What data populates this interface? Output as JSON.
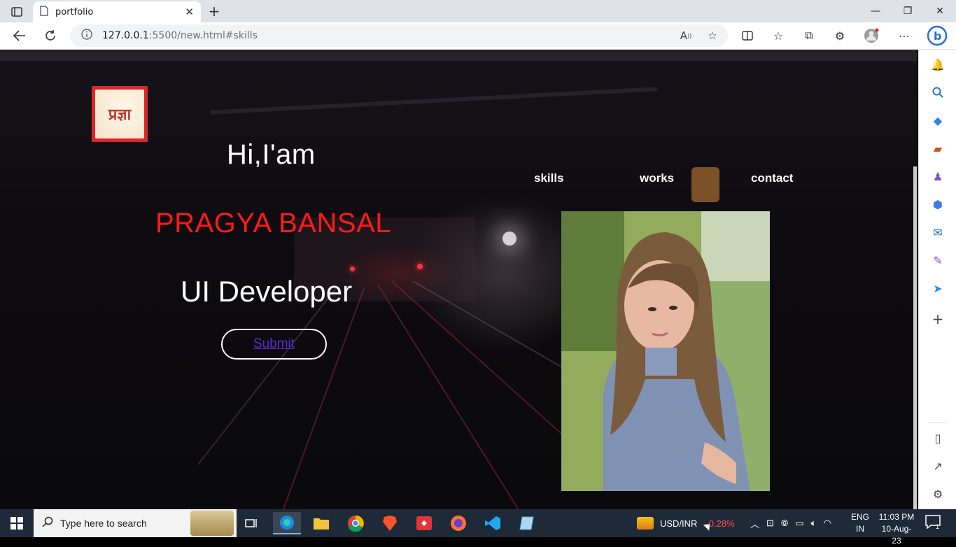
{
  "browser": {
    "tab_title": "portfolio",
    "url_host": "127.0.0.1",
    "url_path": ":5500/new.html#skills"
  },
  "page": {
    "greeting": "Hi,I'am",
    "name": "PRAGYA BANSAL",
    "role": "UI Developer",
    "submit_label": "Submit",
    "logo_text": "प्रज्ञा",
    "nav": [
      "skills",
      "works",
      "contact"
    ]
  },
  "taskbar": {
    "search_placeholder": "Type here to search",
    "ticker_symbol": "USD/INR",
    "ticker_change": "-0.28%",
    "lang_top": "ENG",
    "lang_bottom": "IN",
    "time": "11:03 PM",
    "date": "10-Aug-23",
    "notification_count": "1"
  },
  "colors": {
    "name": "#ff1a1a",
    "submit_text": "#5b2bd1",
    "ticker_change": "#ff4d4d"
  }
}
